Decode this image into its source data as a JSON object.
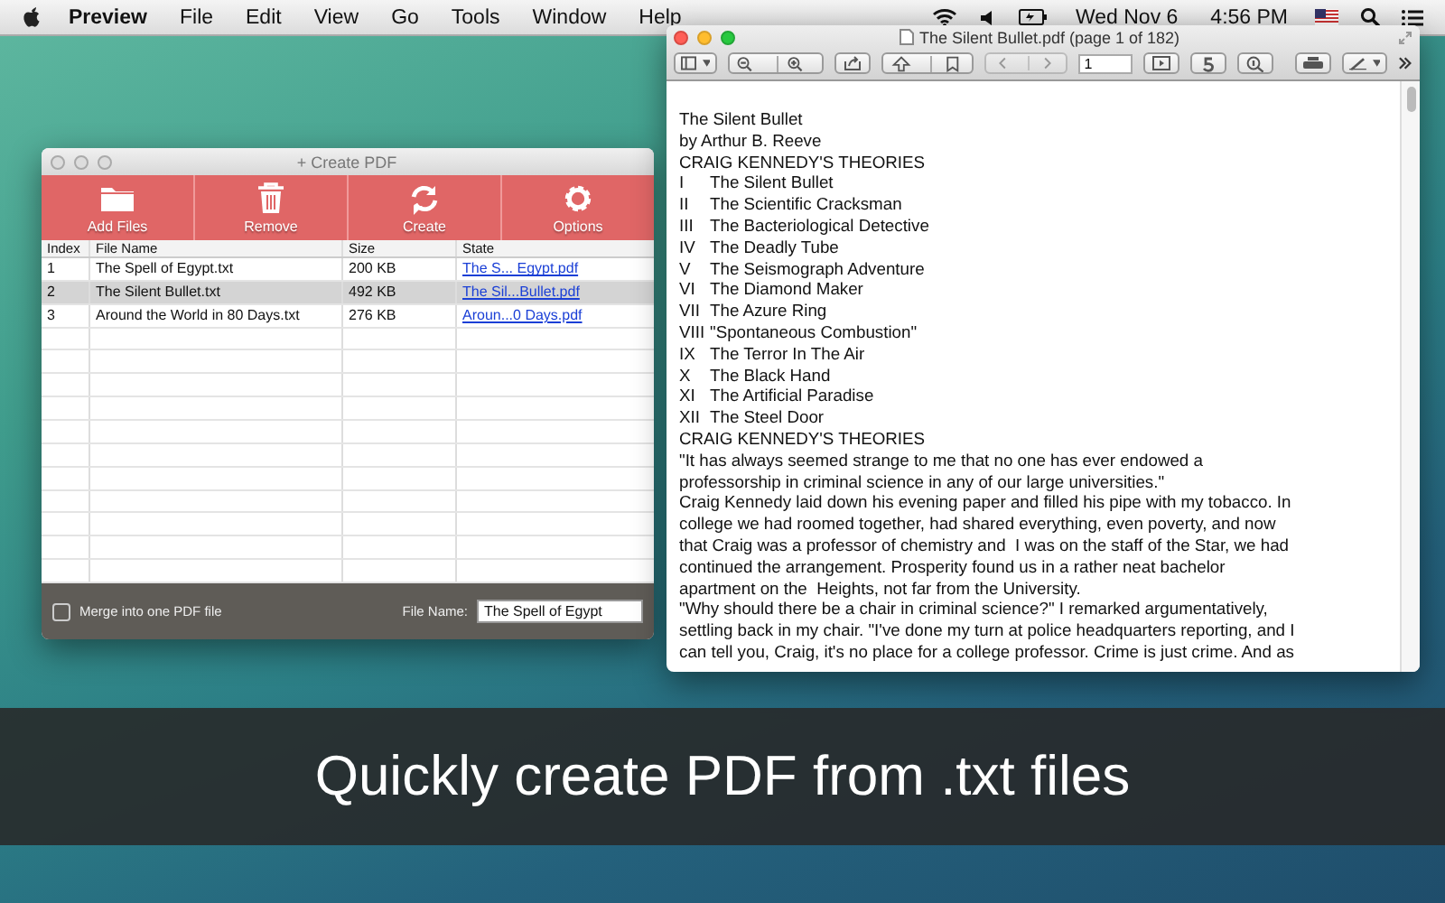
{
  "menu_bar": {
    "app": "Preview",
    "items": [
      "File",
      "Edit",
      "View",
      "Go",
      "Tools",
      "Window",
      "Help"
    ],
    "date": "Wed Nov 6",
    "time": "4:56 PM"
  },
  "create_window": {
    "title": "+ Create PDF",
    "toolbar": [
      {
        "label": "Add Files",
        "kind": "folder"
      },
      {
        "label": "Remove",
        "kind": "trash"
      },
      {
        "label": "Create",
        "kind": "refresh"
      },
      {
        "label": "Options",
        "kind": "gear"
      }
    ],
    "columns": [
      "Index",
      "File Name",
      "Size",
      "State"
    ],
    "rows": [
      {
        "index": "1",
        "file": "The Spell of Egypt.txt",
        "size": "200 KB",
        "state": "The S... Egypt.pdf",
        "selected": false
      },
      {
        "index": "2",
        "file": "The Silent Bullet.txt",
        "size": "492 KB",
        "state": "The Sil...Bullet.pdf",
        "selected": true
      },
      {
        "index": "3",
        "file": "Around the World in 80 Days.txt",
        "size": "276 KB",
        "state": "Aroun...0 Days.pdf",
        "selected": false
      }
    ],
    "merge": {
      "label": "Merge into one PDF file",
      "checked": false
    },
    "file_name": {
      "label": "File Name:",
      "value": "The Spell of Egypt"
    }
  },
  "preview_window": {
    "title": "The Silent Bullet.pdf (page 1 of 182)",
    "page_field": "1",
    "lines": [
      {
        "kind": "text",
        "text": "The Silent Bullet"
      },
      {
        "kind": "text",
        "text": "by Arthur B. Reeve"
      },
      {
        "kind": "text",
        "text": "CRAIG KENNEDY'S THEORIES"
      },
      {
        "kind": "toc",
        "numeral": "I",
        "title": "The Silent Bullet"
      },
      {
        "kind": "toc",
        "numeral": "II",
        "title": "The Scientific Cracksman"
      },
      {
        "kind": "toc",
        "numeral": "III",
        "title": "The Bacteriological Detective"
      },
      {
        "kind": "toc",
        "numeral": "IV",
        "title": "The Deadly Tube"
      },
      {
        "kind": "toc",
        "numeral": "V",
        "title": "The Seismograph Adventure"
      },
      {
        "kind": "toc",
        "numeral": "VI",
        "title": "The Diamond Maker"
      },
      {
        "kind": "toc",
        "numeral": "VII",
        "title": "The Azure Ring"
      },
      {
        "kind": "toc",
        "numeral": "VIII",
        "title": "\"Spontaneous Combustion\""
      },
      {
        "kind": "toc",
        "numeral": "IX",
        "title": "The Terror In The Air"
      },
      {
        "kind": "toc",
        "numeral": "X",
        "title": "The Black Hand"
      },
      {
        "kind": "toc",
        "numeral": "XI",
        "title": "The Artificial Paradise"
      },
      {
        "kind": "toc",
        "numeral": "XII",
        "title": "The Steel Door"
      },
      {
        "kind": "text",
        "text": "CRAIG KENNEDY'S THEORIES"
      },
      {
        "kind": "text",
        "text": "\"It has always seemed strange to me that no one has ever endowed a"
      },
      {
        "kind": "text",
        "text": "professorship in criminal science in any of our large universities.\""
      },
      {
        "kind": "text",
        "text": "Craig Kennedy laid down his evening paper and filled his pipe with my tobacco. In"
      },
      {
        "kind": "text",
        "text": "college we had roomed together, had shared everything, even poverty, and now"
      },
      {
        "kind": "text",
        "text": "that Craig was a professor of chemistry and  I was on the staff of the Star, we had"
      },
      {
        "kind": "text",
        "text": "continued the arrangement. Prosperity found us in a rather neat bachelor"
      },
      {
        "kind": "text",
        "text": "apartment on the  Heights, not far from the University."
      },
      {
        "kind": "text",
        "text": "\"Why should there be a chair in criminal science?\" I remarked argumentatively,"
      },
      {
        "kind": "text",
        "text": "settling back in my chair. \"I've done my turn at police headquarters reporting, and I"
      },
      {
        "kind": "text",
        "text": "can tell you, Craig, it's no place for a college professor. Crime is just crime. And as"
      }
    ]
  },
  "caption": "Quickly create PDF from .txt files"
}
